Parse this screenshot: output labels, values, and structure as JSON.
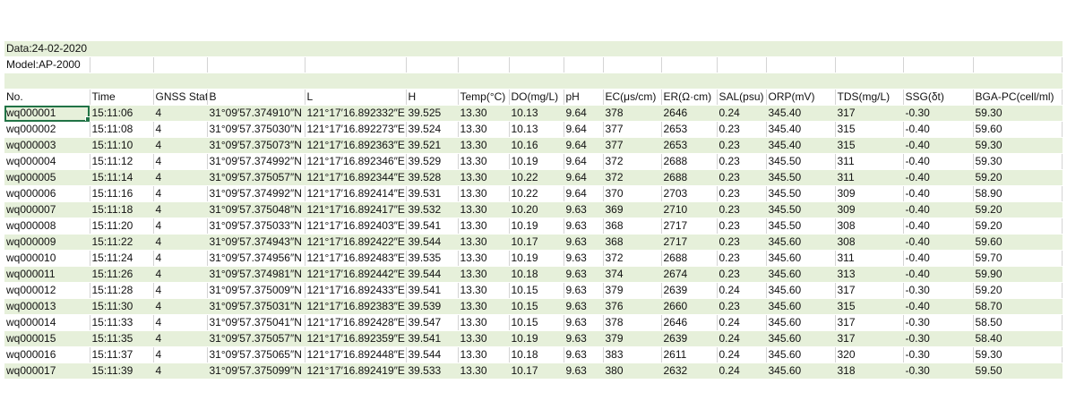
{
  "meta": {
    "date_label": "Data:24-02-2020",
    "model_label": "Model:AP-2000"
  },
  "colors": {
    "band": "#e6f0da",
    "selection": "#217346"
  },
  "headers": [
    "No.",
    "Time",
    "GNSS Statu",
    "B",
    "L",
    "H",
    "Temp(°C)",
    "DO(mg/L)",
    "pH",
    "EC(μs/cm)",
    "ER(Ω·cm)",
    "SAL(psu)",
    "ORP(mV)",
    "TDS(mg/L)",
    "SSG(δt)",
    "BGA-PC(cell/ml)"
  ],
  "rows": [
    [
      "wq000001",
      "15:11:06",
      "4",
      "31°09′57.374910″N",
      "121°17′16.892332″E",
      "39.525",
      "13.30",
      "10.13",
      "9.64",
      "378",
      "2646",
      "0.24",
      "345.40",
      "317",
      "-0.30",
      "59.30"
    ],
    [
      "wq000002",
      "15:11:08",
      "4",
      "31°09′57.375030″N",
      "121°17′16.892273″E",
      "39.524",
      "13.30",
      "10.13",
      "9.64",
      "377",
      "2653",
      "0.23",
      "345.40",
      "315",
      "-0.40",
      "59.60"
    ],
    [
      "wq000003",
      "15:11:10",
      "4",
      "31°09′57.375073″N",
      "121°17′16.892363″E",
      "39.521",
      "13.30",
      "10.16",
      "9.64",
      "377",
      "2653",
      "0.23",
      "345.40",
      "315",
      "-0.40",
      "59.30"
    ],
    [
      "wq000004",
      "15:11:12",
      "4",
      "31°09′57.374992″N",
      "121°17′16.892346″E",
      "39.529",
      "13.30",
      "10.19",
      "9.64",
      "372",
      "2688",
      "0.23",
      "345.50",
      "311",
      "-0.40",
      "59.30"
    ],
    [
      "wq000005",
      "15:11:14",
      "4",
      "31°09′57.375057″N",
      "121°17′16.892344″E",
      "39.528",
      "13.30",
      "10.22",
      "9.64",
      "372",
      "2688",
      "0.23",
      "345.50",
      "311",
      "-0.40",
      "59.20"
    ],
    [
      "wq000006",
      "15:11:16",
      "4",
      "31°09′57.374992″N",
      "121°17′16.892414″E",
      "39.531",
      "13.30",
      "10.22",
      "9.64",
      "370",
      "2703",
      "0.23",
      "345.50",
      "309",
      "-0.40",
      "58.90"
    ],
    [
      "wq000007",
      "15:11:18",
      "4",
      "31°09′57.375048″N",
      "121°17′16.892417″E",
      "39.532",
      "13.30",
      "10.20",
      "9.63",
      "369",
      "2710",
      "0.23",
      "345.50",
      "309",
      "-0.40",
      "59.20"
    ],
    [
      "wq000008",
      "15:11:20",
      "4",
      "31°09′57.375033″N",
      "121°17′16.892403″E",
      "39.541",
      "13.30",
      "10.19",
      "9.63",
      "368",
      "2717",
      "0.23",
      "345.50",
      "308",
      "-0.40",
      "59.20"
    ],
    [
      "wq000009",
      "15:11:22",
      "4",
      "31°09′57.374943″N",
      "121°17′16.892422″E",
      "39.544",
      "13.30",
      "10.17",
      "9.63",
      "368",
      "2717",
      "0.23",
      "345.60",
      "308",
      "-0.40",
      "59.60"
    ],
    [
      "wq000010",
      "15:11:24",
      "4",
      "31°09′57.374956″N",
      "121°17′16.892483″E",
      "39.535",
      "13.30",
      "10.19",
      "9.63",
      "372",
      "2688",
      "0.23",
      "345.60",
      "311",
      "-0.40",
      "59.70"
    ],
    [
      "wq000011",
      "15:11:26",
      "4",
      "31°09′57.374981″N",
      "121°17′16.892442″E",
      "39.544",
      "13.30",
      "10.18",
      "9.63",
      "374",
      "2674",
      "0.23",
      "345.60",
      "313",
      "-0.40",
      "59.90"
    ],
    [
      "wq000012",
      "15:11:28",
      "4",
      "31°09′57.375009″N",
      "121°17′16.892433″E",
      "39.541",
      "13.30",
      "10.15",
      "9.63",
      "379",
      "2639",
      "0.24",
      "345.60",
      "317",
      "-0.30",
      "59.20"
    ],
    [
      "wq000013",
      "15:11:30",
      "4",
      "31°09′57.375031″N",
      "121°17′16.892383″E",
      "39.539",
      "13.30",
      "10.15",
      "9.63",
      "376",
      "2660",
      "0.23",
      "345.60",
      "315",
      "-0.40",
      "58.70"
    ],
    [
      "wq000014",
      "15:11:33",
      "4",
      "31°09′57.375041″N",
      "121°17′16.892428″E",
      "39.547",
      "13.30",
      "10.15",
      "9.63",
      "378",
      "2646",
      "0.24",
      "345.60",
      "317",
      "-0.30",
      "58.50"
    ],
    [
      "wq000015",
      "15:11:35",
      "4",
      "31°09′57.375057″N",
      "121°17′16.892359″E",
      "39.541",
      "13.30",
      "10.19",
      "9.63",
      "379",
      "2639",
      "0.24",
      "345.60",
      "317",
      "-0.30",
      "58.40"
    ],
    [
      "wq000016",
      "15:11:37",
      "4",
      "31°09′57.375065″N",
      "121°17′16.892448″E",
      "39.544",
      "13.30",
      "10.18",
      "9.63",
      "383",
      "2611",
      "0.24",
      "345.60",
      "320",
      "-0.30",
      "59.30"
    ],
    [
      "wq000017",
      "15:11:39",
      "4",
      "31°09′57.375099″N",
      "121°17′16.892419″E",
      "39.533",
      "13.30",
      "10.17",
      "9.63",
      "380",
      "2632",
      "0.24",
      "345.60",
      "318",
      "-0.30",
      "59.50"
    ]
  ]
}
